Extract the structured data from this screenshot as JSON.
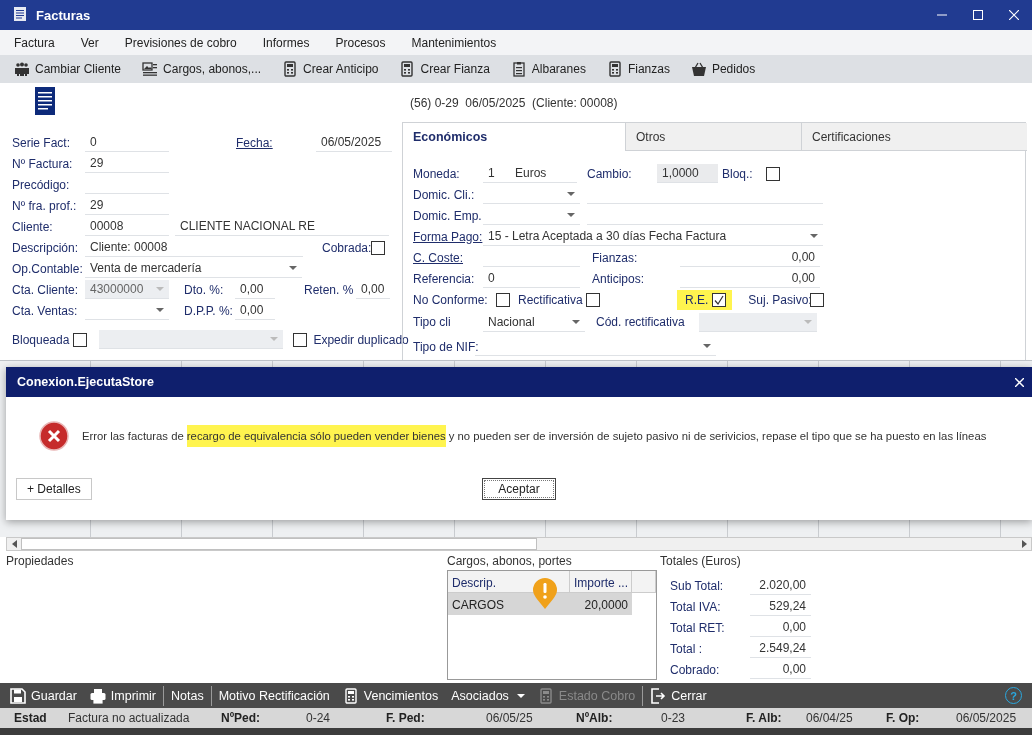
{
  "window": {
    "title": "Facturas"
  },
  "menu": [
    "Factura",
    "Ver",
    "Previsiones de cobro",
    "Informes",
    "Procesos",
    "Mantenimientos"
  ],
  "toolbar": [
    "Cambiar Cliente",
    "Cargos, abonos,...",
    "Crear Anticipo",
    "Crear Fianza",
    "Albaranes",
    "Fianzas",
    "Pedidos"
  ],
  "record_summary": "(56) 0-29  06/05/2025  (Cliente: 00008)",
  "form": {
    "serie_fact": {
      "label": "Serie Fact:",
      "value": "0"
    },
    "fecha": {
      "label": "Fecha:",
      "link": true,
      "value": "06/05/2025"
    },
    "n_factura": {
      "label": "Nº Factura:",
      "value": "29"
    },
    "precodigo": {
      "label": "Precódigo:"
    },
    "n_fra_prof": {
      "label": "Nº fra. prof.:",
      "value": "29"
    },
    "cliente": {
      "label": "Cliente:",
      "value": "00008",
      "name": "CLIENTE NACIONAL RE"
    },
    "descripcion": {
      "label": "Descripción:",
      "value": "Cliente: 00008"
    },
    "cobrada": {
      "label": "Cobrada:",
      "checked": false
    },
    "op_contable": {
      "label": "Op.Contable:",
      "value": "Venta de mercadería"
    },
    "cta_cliente": {
      "label": "Cta. Cliente:",
      "value": "43000000",
      "disabled": true
    },
    "dto": {
      "label": "Dto. %:",
      "value": "0,00"
    },
    "reten": {
      "label": "Reten. %",
      "value": "0,00"
    },
    "cta_ventas": {
      "label": "Cta. Ventas:"
    },
    "dpp": {
      "label": "D.P.P. %:",
      "value": "0,00"
    },
    "bloqueada": {
      "label": "Bloqueada",
      "checked": false
    },
    "bloqueo_motivo": {
      "disabled": true
    },
    "expedir_duplicado": {
      "label": "Expedir duplicado",
      "checked": false
    }
  },
  "tabs": [
    {
      "label": "Económicos",
      "selected": true
    },
    {
      "label": "Otros",
      "selected": false
    },
    {
      "label": "Certificaciones",
      "selected": false
    }
  ],
  "economicos": {
    "moneda": {
      "label": "Moneda:",
      "code": "1",
      "name": "Euros"
    },
    "cambio": {
      "label": "Cambio:",
      "value": "1,0000",
      "read_only": true
    },
    "bloq": {
      "label": "Bloq.:",
      "checked": false
    },
    "domic_cli": {
      "label": "Domic. Cli.:"
    },
    "domic_emp": {
      "label": "Domic. Emp."
    },
    "forma_pago": {
      "label": "Forma Pago:",
      "link": true,
      "value": "15 - Letra Aceptada a 30 días Fecha Factura"
    },
    "c_coste": {
      "label": "C. Coste:",
      "link": true
    },
    "fianzas": {
      "label": "Fianzas:",
      "value": "0,00"
    },
    "referencia": {
      "label": "Referencia:",
      "value": "0"
    },
    "anticipos": {
      "label": "Anticipos:",
      "value": "0,00"
    },
    "no_conforme": {
      "label": "No Conforme:",
      "checked": false
    },
    "rectificativa": {
      "label": "Rectificativa",
      "checked": false
    },
    "re": {
      "label": "R.E.",
      "checked": true,
      "highlighted": true
    },
    "suj_pasivo": {
      "label": "Suj. Pasivo:",
      "checked": false
    },
    "tipo_cli": {
      "label": "Tipo cli",
      "value": "Nacional"
    },
    "cod_rectificativa": {
      "label": "Cód. rectificativa",
      "disabled": true
    },
    "tipo_nif": {
      "label": "Tipo de NIF:"
    }
  },
  "dialog": {
    "title": "Conexion.EjecutaStore",
    "message": [
      {
        "text": "Error las facturas de ",
        "highlighted": false
      },
      {
        "text": "recargo de equivalencia sólo pueden vender bienes",
        "highlighted": true
      },
      {
        "text": " y no pueden ser de inversión de sujeto pasivo ni de serivicios, repase el tipo que se ha puesto en las líneas",
        "highlighted": false
      }
    ],
    "details_button": "+ Detalles",
    "accept_button": "Aceptar"
  },
  "propiedades": {
    "title": "Propiedades"
  },
  "cargos": {
    "title": "Cargos, abonos, portes",
    "columns": [
      "Descrip.",
      "Importe ..."
    ],
    "rows": [
      {
        "descrip": "CARGOS",
        "importe": "20,0000",
        "selected": true
      }
    ]
  },
  "totales": {
    "title": "Totales (Euros)",
    "rows": [
      {
        "label": "Sub Total:",
        "value": "2.020,00"
      },
      {
        "label": "Total IVA:",
        "value": "529,24"
      },
      {
        "label": "Total RET:",
        "value": "0,00"
      },
      {
        "label": "Total :",
        "value": "2.549,24"
      },
      {
        "label": "Cobrado:",
        "value": "0,00"
      }
    ]
  },
  "actions": [
    {
      "label": "Guardar",
      "kind": "button",
      "disabled": false,
      "separator_before": false
    },
    {
      "label": "Imprimir",
      "kind": "button",
      "disabled": false,
      "separator_before": false
    },
    {
      "label": "Notas",
      "kind": "button",
      "disabled": false,
      "separator_before": true
    },
    {
      "label": "Motivo Rectificación",
      "kind": "button",
      "disabled": false,
      "separator_before": true
    },
    {
      "label": "Vencimientos",
      "kind": "button",
      "disabled": false,
      "separator_before": false
    },
    {
      "label": "Asociados",
      "kind": "menu",
      "disabled": false,
      "separator_before": false
    },
    {
      "label": "Estado Cobro",
      "kind": "button",
      "disabled": true,
      "separator_before": false
    },
    {
      "label": "Cerrar",
      "kind": "button",
      "disabled": false,
      "separator_before": true
    }
  ],
  "help": "?",
  "status_bar": [
    {
      "text": "Estad",
      "kind": "label"
    },
    {
      "text": "Factura no actualizada",
      "kind": "value"
    },
    {
      "text": "NºPed:",
      "kind": "label"
    },
    {
      "text": "0-24",
      "kind": "value"
    },
    {
      "text": "F. Ped:",
      "kind": "label"
    },
    {
      "text": "06/05/25",
      "kind": "value"
    },
    {
      "text": "NºAlb:",
      "kind": "label"
    },
    {
      "text": "0-23",
      "kind": "value"
    },
    {
      "text": "F. Alb:",
      "kind": "label"
    },
    {
      "text": "06/04/25",
      "kind": "value"
    },
    {
      "text": "F. Op:",
      "kind": "label"
    },
    {
      "text": "06/05/2025",
      "kind": "value"
    }
  ]
}
